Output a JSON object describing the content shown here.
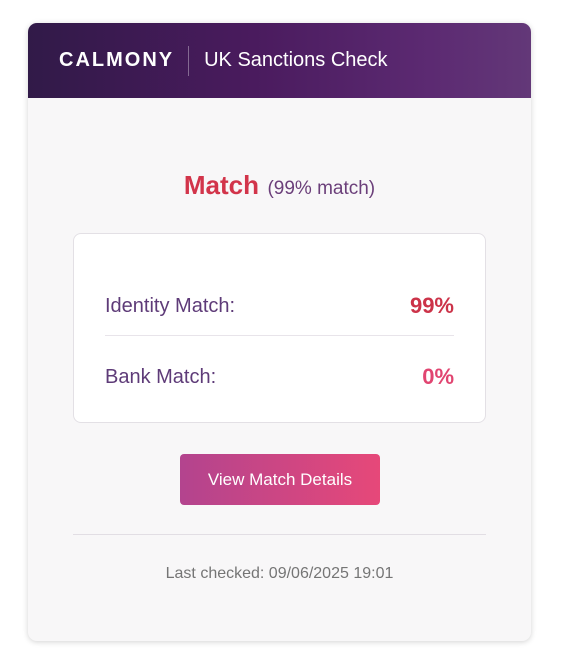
{
  "header": {
    "brand": "CALMONY",
    "title": "UK Sanctions Check"
  },
  "status": {
    "label": "Match",
    "detail": "(99% match)"
  },
  "results": [
    {
      "label": "Identity Match:",
      "value": "99%"
    },
    {
      "label": "Bank Match:",
      "value": "0%"
    }
  ],
  "actions": {
    "view_details_label": "View Match Details"
  },
  "footer": {
    "last_checked": "Last checked: 09/06/2025 19:01"
  },
  "colors": {
    "header_start": "#311a48",
    "header_end": "#633878",
    "match_red": "#d2344a",
    "button_start": "#b3448e",
    "button_end": "#e64879"
  }
}
